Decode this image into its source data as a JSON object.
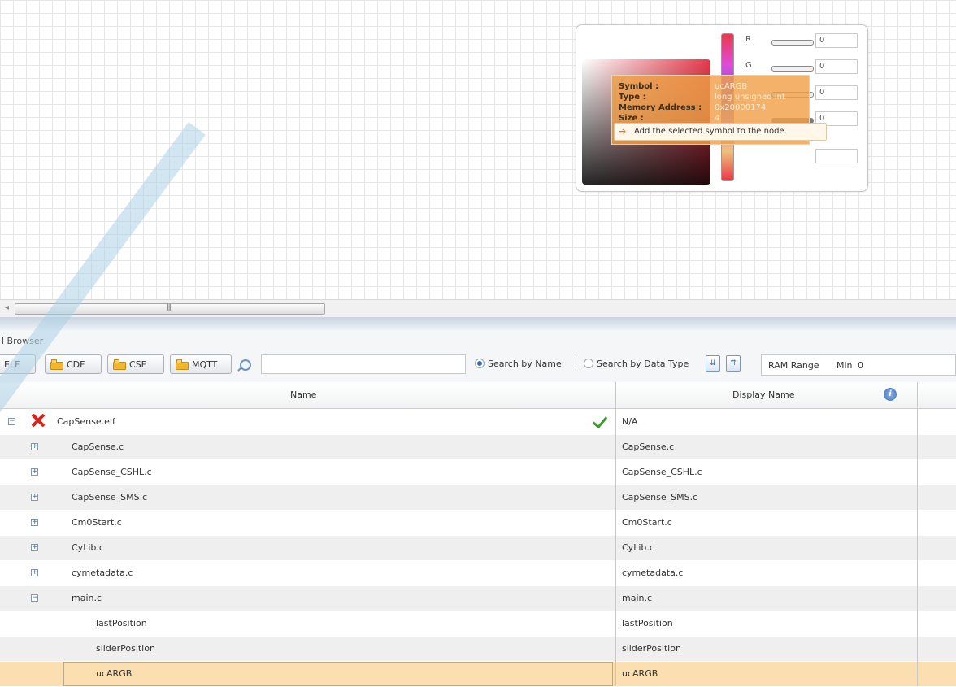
{
  "panel": {
    "title": "l Browser"
  },
  "toolbar": {
    "elf_label": "ELF",
    "cdf_label": "CDF",
    "csf_label": "CSF",
    "mqtt_label": "MQTT",
    "search_value": "",
    "search_by_name": "Search by Name",
    "search_by_type": "Search by Data Type",
    "ram_range_label": "RAM Range",
    "ram_min_label": "Min",
    "ram_min_value": "0"
  },
  "grid": {
    "col_name": "Name",
    "col_display": "Display Name",
    "info_icon": "i",
    "rows": [
      {
        "name": "CapSense.elf",
        "display": "N/A"
      },
      {
        "name": "CapSense.c",
        "display": "CapSense.c"
      },
      {
        "name": "CapSense_CSHL.c",
        "display": "CapSense_CSHL.c"
      },
      {
        "name": "CapSense_SMS.c",
        "display": "CapSense_SMS.c"
      },
      {
        "name": "Cm0Start.c",
        "display": "Cm0Start.c"
      },
      {
        "name": "CyLib.c",
        "display": "CyLib.c"
      },
      {
        "name": "cymetadata.c",
        "display": "cymetadata.c"
      },
      {
        "name": "main.c",
        "display": "main.c"
      },
      {
        "name": "lastPosition",
        "display": "lastPosition"
      },
      {
        "name": "sliderPosition",
        "display": "sliderPosition"
      },
      {
        "name": "ucARGB",
        "display": "ucARGB"
      }
    ]
  },
  "color_widget": {
    "r_label": "R",
    "r_value": "0",
    "g_label": "G",
    "g_value": "0",
    "b_value": "0",
    "a_value": "0"
  },
  "tooltip": {
    "symbol_key": "Symbol :",
    "symbol_val": "ucARGB",
    "type_key": "Type :",
    "type_val": "long unsigned int",
    "addr_key": "Memory Address :",
    "addr_val": "0x20000174",
    "size_key": "Size :",
    "size_val": "4",
    "action": "Add the selected symbol to the node."
  },
  "colors": {
    "selected_row": "#fbdfb0",
    "alt_row": "#efefef",
    "accent": "#3c6fb4"
  },
  "icons": [
    "folder-icon",
    "search-icon",
    "error-x-icon",
    "check-icon",
    "info-icon",
    "expand-icon",
    "arrow-right-icon"
  ]
}
